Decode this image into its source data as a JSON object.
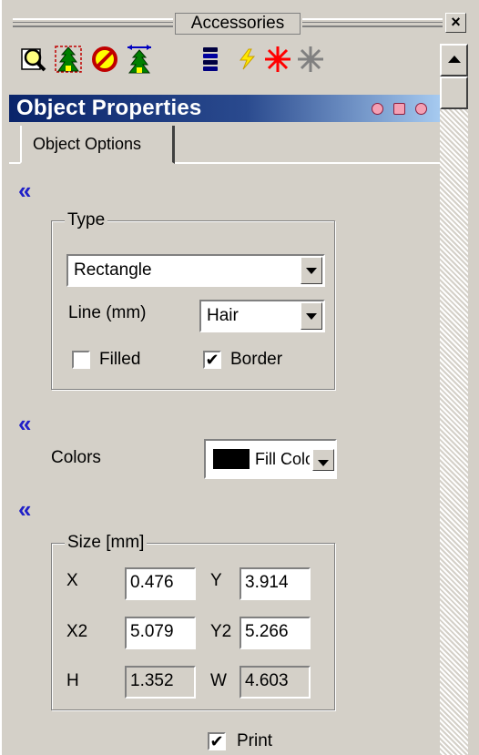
{
  "toolbar_window": {
    "title": "Accessories",
    "close_glyph": "×"
  },
  "toolbar": {
    "icons": [
      "zoom-page-icon",
      "text-object-icon",
      "no-symbol-icon",
      "resize-object-icon",
      "stack-icon",
      "lightning-icon",
      "red-star-icon",
      "gray-star-icon"
    ]
  },
  "panel": {
    "title": "Object Properties",
    "tab": "Object Options",
    "collapse_glyph": "«"
  },
  "type_group": {
    "legend": "Type",
    "shape_value": "Rectangle",
    "line_label": "Line (mm)",
    "line_value": "Hair",
    "filled_label": "Filled",
    "filled_checked": false,
    "border_label": "Border",
    "border_checked": true
  },
  "colors": {
    "label": "Colors",
    "dropdown_text": "Fill Color",
    "swatch_color": "#000000"
  },
  "size_group": {
    "legend": "Size [mm]",
    "x_label": "X",
    "x_value": "0.476",
    "y_label": "Y",
    "y_value": "3.914",
    "x2_label": "X2",
    "x2_value": "5.079",
    "y2_label": "Y2",
    "y2_value": "5.266",
    "h_label": "H",
    "h_value": "1.352",
    "w_label": "W",
    "w_value": "4.603"
  },
  "print": {
    "label": "Print",
    "checked": true
  },
  "check_glyph": "✔",
  "colors_theme": {
    "header_start": "#0a246a",
    "header_end": "#a6caf0",
    "collapse_arrow": "#2020c8",
    "button_face": "#d4d0c8"
  }
}
